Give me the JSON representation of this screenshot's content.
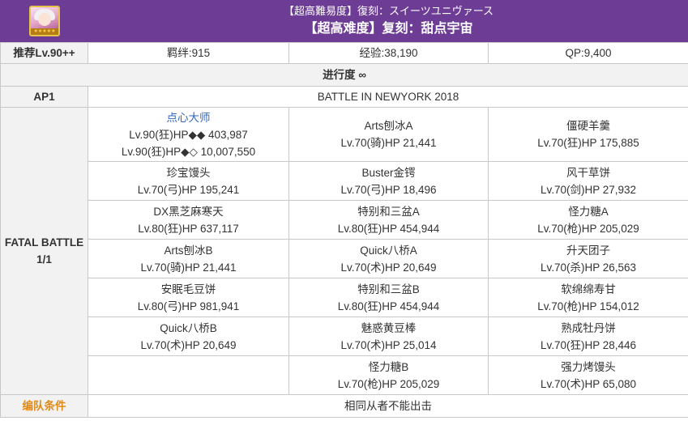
{
  "header": {
    "title_jp": "【超高難易度】復刻：スイーツユニヴァース",
    "title_cn": "【超高难度】复刻：甜点宇宙",
    "accent_color": "#6d3d96"
  },
  "rewards": {
    "recommend": "推荐Lv.90++",
    "bond": "羁绊:915",
    "exp": "经验:38,190",
    "qp": "QP:9,400"
  },
  "progress": "进行度 ∞",
  "ap": {
    "label": "AP1",
    "battle": "BATTLE IN NEWYORK 2018"
  },
  "fatal": {
    "label": "FATAL BATTLE",
    "count": "1/1"
  },
  "enemies": [
    {
      "col1": {
        "name": "点心大师",
        "hp1": "Lv.90(狂)HP◆◆ 403,987",
        "hp2": "Lv.90(狂)HP◆◇ 10,007,550"
      },
      "col2": {
        "name": "Arts刨冰A",
        "hp1": "Lv.70(骑)HP 21,441"
      },
      "col3": {
        "name": "僵硬羊羹",
        "hp1": "Lv.70(狂)HP 175,885"
      }
    },
    {
      "col1": {
        "name": "珍宝馒头",
        "hp1": "Lv.70(弓)HP 195,241"
      },
      "col2": {
        "name": "Buster金锷",
        "hp1": "Lv.70(弓)HP 18,496"
      },
      "col3": {
        "name": "风干草饼",
        "hp1": "Lv.70(剑)HP 27,932"
      }
    },
    {
      "col1": {
        "name": "DX黑芝麻寒天",
        "hp1": "Lv.80(狂)HP 637,117"
      },
      "col2": {
        "name": "特别和三盆A",
        "hp1": "Lv.80(狂)HP 454,944"
      },
      "col3": {
        "name": "怪力糖A",
        "hp1": "Lv.70(枪)HP 205,029"
      }
    },
    {
      "col1": {
        "name": "Arts刨冰B",
        "hp1": "Lv.70(骑)HP 21,441"
      },
      "col2": {
        "name": "Quick八桥A",
        "hp1": "Lv.70(术)HP 20,649"
      },
      "col3": {
        "name": "升天团子",
        "hp1": "Lv.70(杀)HP 26,563"
      }
    },
    {
      "col1": {
        "name": "安眠毛豆饼",
        "hp1": "Lv.80(弓)HP 981,941"
      },
      "col2": {
        "name": "特别和三盆B",
        "hp1": "Lv.80(狂)HP 454,944"
      },
      "col3": {
        "name": "软绵绵寿甘",
        "hp1": "Lv.70(枪)HP 154,012"
      }
    },
    {
      "col1": {
        "name": "Quick八桥B",
        "hp1": "Lv.70(术)HP 20,649"
      },
      "col2": {
        "name": "魅惑黄豆棒",
        "hp1": "Lv.70(术)HP 25,014"
      },
      "col3": {
        "name": "熟成牡丹饼",
        "hp1": "Lv.70(狂)HP 28,446"
      }
    },
    {
      "col2": {
        "name": "怪力糖B",
        "hp1": "Lv.70(枪)HP 205,029"
      },
      "col3": {
        "name": "强力烤馒头",
        "hp1": "Lv.70(术)HP 65,080"
      }
    }
  ],
  "condition": {
    "label": "编队条件",
    "value": "相同从者不能出击"
  }
}
